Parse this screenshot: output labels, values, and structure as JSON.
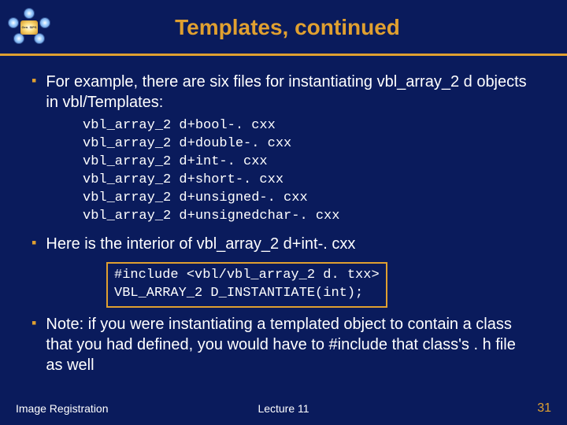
{
  "header": {
    "title": "Templates, continued",
    "logo_label": "Gen. SIPS"
  },
  "bullets": {
    "b1": "For example, there are six files for instantiating vbl_array_2 d objects in vbl/Templates:",
    "b2": "Here is the interior of vbl_array_2 d+int-. cxx",
    "b3": "Note:  if you were instantiating a templated object to contain a class that you had defined, you would have to #include that class's . h file as well"
  },
  "code1": {
    "l1": "vbl_array_2 d+bool-. cxx",
    "l2": "vbl_array_2 d+double-. cxx",
    "l3": "vbl_array_2 d+int-. cxx",
    "l4": "vbl_array_2 d+short-. cxx",
    "l5": "vbl_array_2 d+unsigned-. cxx",
    "l6": "vbl_array_2 d+unsignedchar-. cxx"
  },
  "code2": {
    "l1": "#include <vbl/vbl_array_2 d. txx>",
    "l2": "VBL_ARRAY_2 D_INSTANTIATE(int);"
  },
  "footer": {
    "left": "Image Registration",
    "center": "Lecture 11",
    "right": "31"
  }
}
